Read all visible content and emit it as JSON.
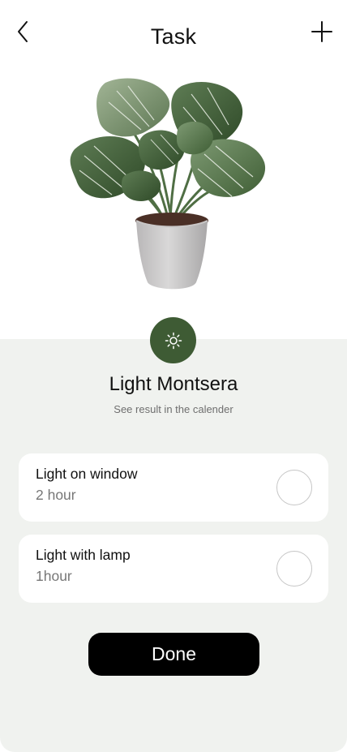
{
  "header": {
    "title": "Task",
    "back_icon": "chevron-left-icon",
    "add_icon": "plus-icon"
  },
  "plant": {
    "icon": "monstera-plant-illustration"
  },
  "task": {
    "icon": "sun-icon",
    "title": "Light Montsera",
    "subtitle": "See result in the calender"
  },
  "options": [
    {
      "label": "Light on window",
      "duration": "2 hour",
      "checked": false
    },
    {
      "label": "Light with lamp",
      "duration": "1hour",
      "checked": false
    }
  ],
  "actions": {
    "done_label": "Done"
  },
  "colors": {
    "accent_green": "#3e5b34",
    "sheet_background": "#f0f2ef",
    "button_black": "#000000"
  }
}
